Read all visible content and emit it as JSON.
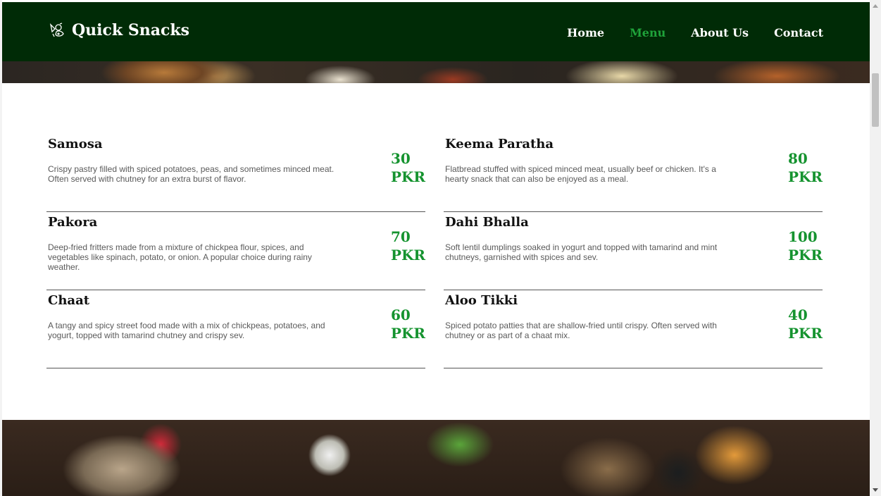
{
  "brand": {
    "name": "Quick Snacks",
    "icon": "snack-logo-icon"
  },
  "nav": {
    "links": [
      {
        "label": "Home",
        "active": false
      },
      {
        "label": "Menu",
        "active": true
      },
      {
        "label": "About Us",
        "active": false
      },
      {
        "label": "Contact",
        "active": false
      }
    ]
  },
  "colors": {
    "nav_bg": "#002b06",
    "accent": "#15932f",
    "active_link": "#1fa33a"
  },
  "menu": {
    "items": [
      {
        "title": "Samosa",
        "description": "Crispy pastry filled with spiced potatoes, peas, and sometimes minced meat. Often served with chutney for an extra burst of flavor.",
        "price_amount": "30",
        "price_currency": "PKR"
      },
      {
        "title": "Keema Paratha",
        "description": "Flatbread stuffed with spiced minced meat, usually beef or chicken. It's a hearty snack that can also be enjoyed as a meal.",
        "price_amount": "80",
        "price_currency": "PKR"
      },
      {
        "title": "Pakora",
        "description": "Deep-fried fritters made from a mixture of chickpea flour, spices, and vegetables like spinach, potato, or onion. A popular choice during rainy weather.",
        "price_amount": "70",
        "price_currency": "PKR"
      },
      {
        "title": "Dahi Bhalla",
        "description": "Soft lentil dumplings soaked in yogurt and topped with tamarind and mint chutneys, garnished with spices and sev.",
        "price_amount": "100",
        "price_currency": "PKR"
      },
      {
        "title": "Chaat",
        "description": "A tangy and spicy street food made with a mix of chickpeas, potatoes, and yogurt, topped with tamarind chutney and crispy sev.",
        "price_amount": "60",
        "price_currency": "PKR"
      },
      {
        "title": "Aloo Tikki",
        "description": "Spiced potato patties that are shallow-fried until crispy. Often served with chutney or as part of a chaat mix.",
        "price_amount": "40",
        "price_currency": "PKR"
      }
    ]
  }
}
